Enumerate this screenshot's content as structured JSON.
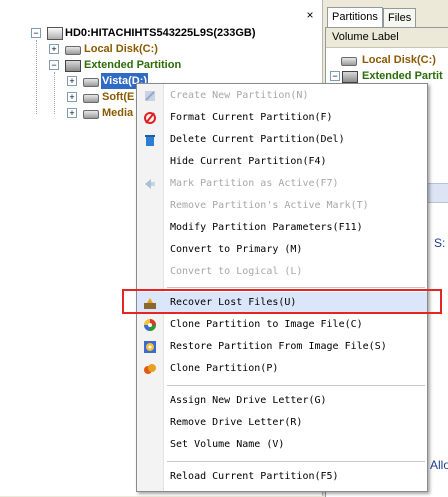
{
  "tree": {
    "root": "HD0:HITACHIHTS543225L9S(233GB)",
    "local_disk": "Local Disk(C:)",
    "extended": "Extended Partition",
    "vista": "Vista(D:)",
    "soft": "Soft(E",
    "media": "Media",
    "close_glyph": "×"
  },
  "right_panel": {
    "tab_partitions": "Partitions",
    "tab_files": "Files",
    "volume_label_header": "Volume Label",
    "local_disk": "Local Disk(C:)",
    "extended": "Extended Partit",
    "s_fragment": "S:",
    "alloc_fragment": "Alloc"
  },
  "menu": {
    "items": [
      {
        "label": "Create New Partition(N)",
        "enabled": false,
        "icon": "create-partition-icon"
      },
      {
        "label": "Format Current Partition(F)",
        "enabled": true,
        "icon": "format-icon"
      },
      {
        "label": "Delete Current Partition(Del)",
        "enabled": true,
        "icon": "trash-icon"
      },
      {
        "label": "Hide Current Partition(F4)",
        "enabled": true,
        "icon": ""
      },
      {
        "label": "Mark Partition as Active(F7)",
        "enabled": false,
        "icon": "mark-active-icon"
      },
      {
        "label": "Remove Partition's Active Mark(T)",
        "enabled": false,
        "icon": ""
      },
      {
        "label": "Modify Partition Parameters(F11)",
        "enabled": true,
        "icon": ""
      },
      {
        "label": "Convert to Primary (M)",
        "enabled": true,
        "icon": ""
      },
      {
        "label": "Convert to Logical (L)",
        "enabled": false,
        "icon": ""
      },
      {
        "label": "Recover Lost Files(U)",
        "enabled": true,
        "icon": "recover-icon"
      },
      {
        "label": "Clone Partition to Image File(C)",
        "enabled": true,
        "icon": "clone-to-image-icon"
      },
      {
        "label": "Restore Partition From Image File(S)",
        "enabled": true,
        "icon": "restore-image-icon"
      },
      {
        "label": "Clone Partition(P)",
        "enabled": true,
        "icon": "clone-partition-icon"
      },
      {
        "label": "Assign New Drive Letter(G)",
        "enabled": true,
        "icon": ""
      },
      {
        "label": "Remove Drive Letter(R)",
        "enabled": true,
        "icon": ""
      },
      {
        "label": "Set Volume Name (V)",
        "enabled": true,
        "icon": ""
      },
      {
        "label": "Reload Current Partition(F5)",
        "enabled": true,
        "icon": ""
      }
    ]
  },
  "colors": {
    "highlight_box": "#e52424",
    "selection": "#316ac5",
    "tree_green": "#2b6d08",
    "tree_brown": "#8b5a00"
  }
}
